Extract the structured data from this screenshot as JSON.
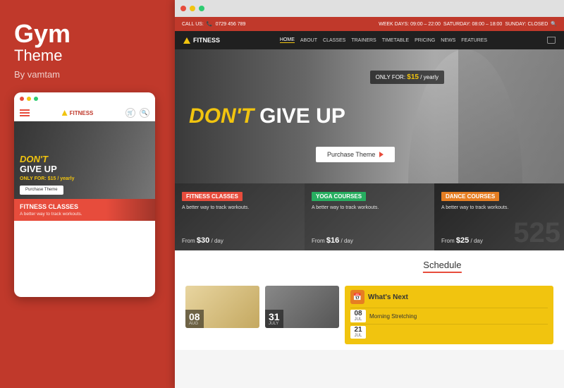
{
  "left": {
    "title": "Gym",
    "subtitle": "Theme",
    "author": "By vamtam"
  },
  "mobile": {
    "dots": [
      "red",
      "yellow",
      "green"
    ],
    "logo": "FITNESS",
    "hero": {
      "dont": "DON'T",
      "giveup": "GIVE UP",
      "price_label": "ONLY FOR:",
      "price": "$15",
      "price_period": "/ yearly"
    },
    "btn": "Purchase Theme",
    "banner": {
      "label": "FITNESS CLASSES",
      "desc": "A better way to track workouts."
    }
  },
  "browser": {
    "topbar": {
      "phone_label": "CALL US:",
      "phone": "0729 456 789",
      "hours": "WEEK DAYS: 09:00 – 22:00",
      "saturday": "SATURDAY: 08:00 – 18:00",
      "sunday": "SUNDAY: CLOSED"
    },
    "nav": {
      "logo": "FITNESS",
      "links": [
        "HOME",
        "ABOUT",
        "CLASSES",
        "TRAINERS",
        "TIMETABLE",
        "PRICING",
        "NEWS",
        "FEATURES"
      ],
      "active_index": 0
    },
    "hero": {
      "dont": "DON'T",
      "giveup": "GIVE UP",
      "price_label": "ONLY FOR:",
      "price": "$15",
      "price_period": "/ yearly",
      "btn": "Purchase Theme"
    },
    "courses": [
      {
        "label": "FITNESS CLASSES",
        "desc": "A better way to track workouts.",
        "price_from": "From",
        "price": "$30",
        "price_period": "/ day",
        "number": ""
      },
      {
        "label": "YOGA COURSES",
        "desc": "A better way to track workouts.",
        "price_from": "From",
        "price": "$16",
        "price_period": "/ day",
        "number": ""
      },
      {
        "label": "DANCE COURSES",
        "desc": "A better way to track workouts.",
        "price_from": "From",
        "price": "$25",
        "price_period": "/ day",
        "number": "525"
      }
    ],
    "schedule": {
      "title": "Schedule",
      "cards": [
        {
          "date_num": "08",
          "date_month": "AUG"
        },
        {
          "date_num": "31",
          "date_month": "JULY"
        }
      ],
      "whats_next": {
        "title": "What's Next",
        "events": [
          {
            "date_num": "08",
            "date_month": "JUL",
            "name": "Morning Stretching"
          },
          {
            "date_num": "21",
            "date_month": "JUL",
            "name": ""
          }
        ]
      }
    }
  }
}
